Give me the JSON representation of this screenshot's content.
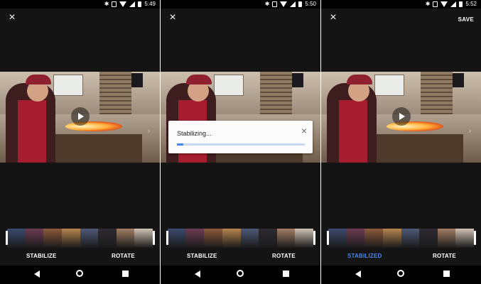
{
  "panels": [
    {
      "status": {
        "time": "5:49"
      },
      "topbar": {
        "close_glyph": "×",
        "save_label": ""
      },
      "stabilize_label": "STABILIZE",
      "rotate_label": "ROTATE"
    },
    {
      "status": {
        "time": "5:50"
      },
      "topbar": {
        "close_glyph": "×",
        "save_label": ""
      },
      "dialog": {
        "message": "Stabilizing...",
        "close_glyph": "×",
        "progress_fraction": 0.05
      },
      "stabilize_label": "STABILIZE",
      "rotate_label": "ROTATE"
    },
    {
      "status": {
        "time": "5:52"
      },
      "topbar": {
        "close_glyph": "×",
        "save_label": "SAVE"
      },
      "stabilize_label": "STABILIZED",
      "rotate_label": "ROTATE"
    }
  ],
  "icons": {
    "status": [
      "bluetooth-icon",
      "vibrate-icon",
      "wifi-icon",
      "cell-signal-icon",
      "battery-icon"
    ],
    "nav": [
      "back-icon",
      "home-icon",
      "recents-icon"
    ],
    "video": "play-icon"
  },
  "colors": {
    "background": "#141414",
    "accent": "#4a88e8",
    "progress": "#4285f4"
  },
  "filmstrip_frames": [
    "#3b4a6e",
    "#6b3c52",
    "#8d5a3a",
    "#b7854f",
    "#4f5a78",
    "#2e2b33",
    "#a37e63",
    "#d1c3b5"
  ]
}
